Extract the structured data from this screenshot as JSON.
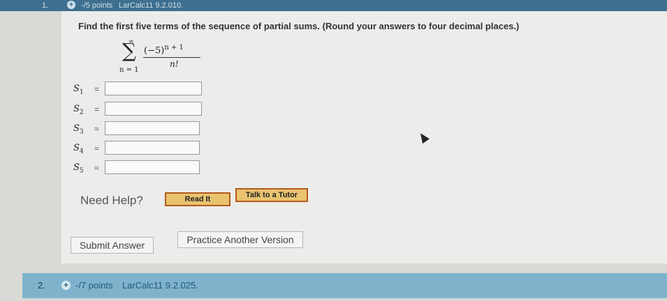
{
  "question1": {
    "number": "1.",
    "points": "-/5 points",
    "code": "LarCalc11 9.2.010.",
    "prompt": "Find the first five terms of the sequence of partial sums. (Round your answers to four decimal places.)",
    "formula": {
      "upper": "∞",
      "sigma": "∑",
      "lower": "n = 1",
      "numerator_base": "(−5)",
      "numerator_exp": "n + 1",
      "denominator": "n!"
    },
    "partial_sums": [
      {
        "label": "S",
        "sub": "1",
        "rel": "=",
        "value": ""
      },
      {
        "label": "S",
        "sub": "2",
        "rel": "=",
        "value": ""
      },
      {
        "label": "S",
        "sub": "3",
        "rel": "≈",
        "value": ""
      },
      {
        "label": "S",
        "sub": "4",
        "rel": "≈",
        "value": ""
      },
      {
        "label": "S",
        "sub": "5",
        "rel": "≈",
        "value": ""
      }
    ],
    "need_help": "Need Help?",
    "read_it": "Read It",
    "talk_tutor": "Talk to a Tutor",
    "submit": "Submit Answer",
    "practice": "Practice Another Version"
  },
  "question2": {
    "number": "2.",
    "points": "-/7 points",
    "code": "LarCalc11 9.2.025."
  },
  "colors": {
    "header_bar": "#3f6f8f",
    "q2_bar": "#7fb3cc",
    "help_button_fill": "#e9c36f",
    "help_button_border": "#b45a1c"
  }
}
